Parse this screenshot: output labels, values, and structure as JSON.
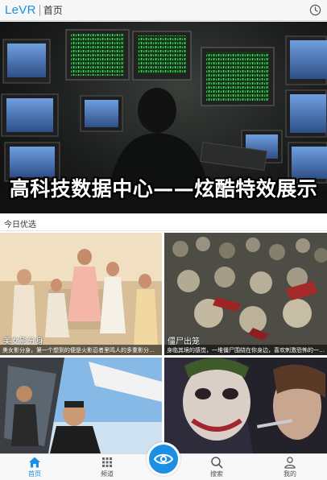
{
  "header": {
    "logo": "LeVR",
    "title": "首页",
    "icons": {
      "history": "clock-icon"
    }
  },
  "banner": {
    "caption": "高科技数据中心——炫酷特效展示",
    "slide_count": 5,
    "active_slide": 1
  },
  "section": {
    "title": "今日优选"
  },
  "tiles": [
    {
      "title": "美女影分身",
      "desc": "美女影分身，第一个想到的便是火影忍者里鸣人的多重影分身了..."
    },
    {
      "title": "僵尸出笼",
      "desc": "身临其境的感觉，一堆僵尸围绕在你身边，喜欢刺激恐怖的一定..."
    },
    {
      "title": "",
      "desc": ""
    },
    {
      "title": "",
      "desc": ""
    }
  ],
  "tabbar": {
    "items": [
      {
        "label": "首页",
        "icon": "home-icon",
        "active": true
      },
      {
        "label": "频道",
        "icon": "grid-icon",
        "active": false
      },
      {
        "label": "",
        "icon": "eye-icon",
        "active": false
      },
      {
        "label": "搜索",
        "icon": "search-icon",
        "active": false
      },
      {
        "label": "我的",
        "icon": "user-icon",
        "active": false
      }
    ]
  },
  "colors": {
    "accent": "#1a8fe3",
    "header_bg": "#f7f7f7",
    "tabbar_bg": "#f8f8f8"
  }
}
